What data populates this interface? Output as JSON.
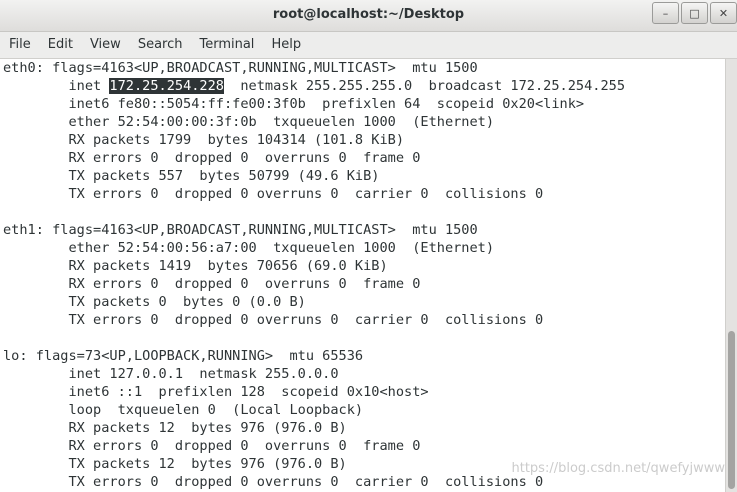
{
  "window": {
    "title": "root@localhost:~/Desktop",
    "buttons": {
      "minimize": "–",
      "maximize": "□",
      "close": "✕"
    }
  },
  "menu": [
    "File",
    "Edit",
    "View",
    "Search",
    "Terminal",
    "Help"
  ],
  "terminal": {
    "lines": [
      {
        "pre": "eth0: flags=4163<UP,BROADCAST,RUNNING,MULTICAST>  mtu 1500",
        "sel": "",
        "post": ""
      },
      {
        "pre": "        inet ",
        "sel": "172.25.254.228",
        "post": "  netmask 255.255.255.0  broadcast 172.25.254.255"
      },
      {
        "pre": "        inet6 fe80::5054:ff:fe00:3f0b  prefixlen 64  scopeid 0x20<link>",
        "sel": "",
        "post": ""
      },
      {
        "pre": "        ether 52:54:00:00:3f:0b  txqueuelen 1000  (Ethernet)",
        "sel": "",
        "post": ""
      },
      {
        "pre": "        RX packets 1799  bytes 104314 (101.8 KiB)",
        "sel": "",
        "post": ""
      },
      {
        "pre": "        RX errors 0  dropped 0  overruns 0  frame 0",
        "sel": "",
        "post": ""
      },
      {
        "pre": "        TX packets 557  bytes 50799 (49.6 KiB)",
        "sel": "",
        "post": ""
      },
      {
        "pre": "        TX errors 0  dropped 0 overruns 0  carrier 0  collisions 0",
        "sel": "",
        "post": ""
      },
      {
        "pre": "",
        "sel": "",
        "post": ""
      },
      {
        "pre": "eth1: flags=4163<UP,BROADCAST,RUNNING,MULTICAST>  mtu 1500",
        "sel": "",
        "post": ""
      },
      {
        "pre": "        ether 52:54:00:56:a7:00  txqueuelen 1000  (Ethernet)",
        "sel": "",
        "post": ""
      },
      {
        "pre": "        RX packets 1419  bytes 70656 (69.0 KiB)",
        "sel": "",
        "post": ""
      },
      {
        "pre": "        RX errors 0  dropped 0  overruns 0  frame 0",
        "sel": "",
        "post": ""
      },
      {
        "pre": "        TX packets 0  bytes 0 (0.0 B)",
        "sel": "",
        "post": ""
      },
      {
        "pre": "        TX errors 0  dropped 0 overruns 0  carrier 0  collisions 0",
        "sel": "",
        "post": ""
      },
      {
        "pre": "",
        "sel": "",
        "post": ""
      },
      {
        "pre": "lo: flags=73<UP,LOOPBACK,RUNNING>  mtu 65536",
        "sel": "",
        "post": ""
      },
      {
        "pre": "        inet 127.0.0.1  netmask 255.0.0.0",
        "sel": "",
        "post": ""
      },
      {
        "pre": "        inet6 ::1  prefixlen 128  scopeid 0x10<host>",
        "sel": "",
        "post": ""
      },
      {
        "pre": "        loop  txqueuelen 0  (Local Loopback)",
        "sel": "",
        "post": ""
      },
      {
        "pre": "        RX packets 12  bytes 976 (976.0 B)",
        "sel": "",
        "post": ""
      },
      {
        "pre": "        RX errors 0  dropped 0  overruns 0  frame 0",
        "sel": "",
        "post": ""
      },
      {
        "pre": "        TX packets 12  bytes 976 (976.0 B)",
        "sel": "",
        "post": ""
      },
      {
        "pre": "        TX errors 0  dropped 0 overruns 0  carrier 0  collisions 0",
        "sel": "",
        "post": ""
      }
    ]
  },
  "watermark": "https://blog.csdn.net/qwefyjwww"
}
